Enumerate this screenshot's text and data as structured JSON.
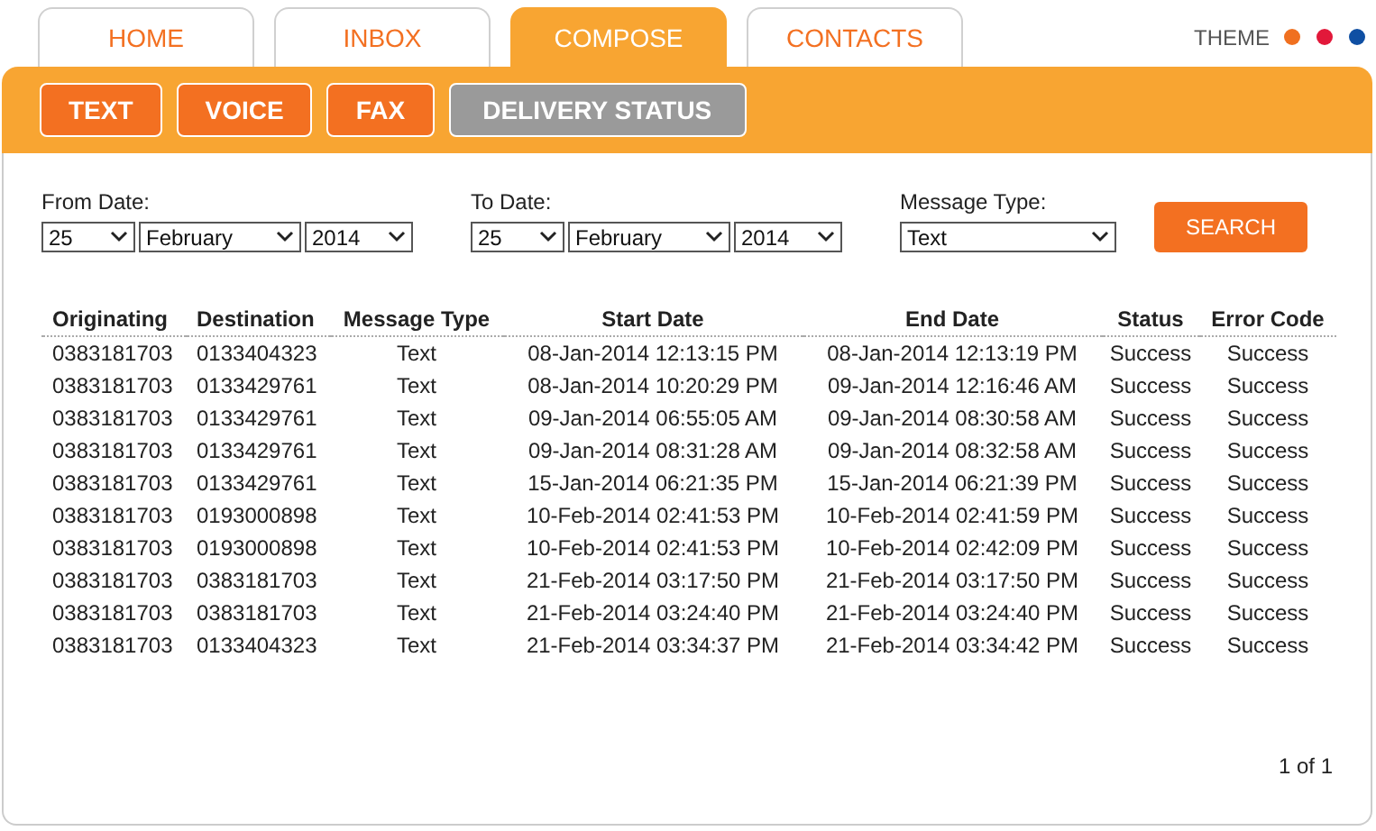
{
  "tabs": [
    {
      "label": "HOME",
      "selected": false
    },
    {
      "label": "INBOX",
      "selected": false
    },
    {
      "label": "COMPOSE",
      "selected": true
    },
    {
      "label": "CONTACTS",
      "selected": false
    }
  ],
  "theme": {
    "label": "THEME",
    "options": [
      {
        "color": "#f07020"
      },
      {
        "color": "#e2183a"
      },
      {
        "color": "#0f4fa3"
      }
    ]
  },
  "subtabs": [
    {
      "label": "TEXT",
      "selected": false
    },
    {
      "label": "VOICE",
      "selected": false
    },
    {
      "label": "FAX",
      "selected": false
    },
    {
      "label": "DELIVERY STATUS",
      "selected": true
    }
  ],
  "filters": [
    {
      "label": "From Date:",
      "fields": [
        {
          "value": "25",
          "kind": "day"
        },
        {
          "value": "February",
          "kind": "month"
        },
        {
          "value": "2014",
          "kind": "year"
        }
      ]
    },
    {
      "label": "To Date:",
      "fields": [
        {
          "value": "25",
          "kind": "day"
        },
        {
          "value": "February",
          "kind": "month"
        },
        {
          "value": "2014",
          "kind": "year"
        }
      ]
    },
    {
      "label": "Message Type:",
      "fields": [
        {
          "value": "Text",
          "kind": "type"
        }
      ]
    }
  ],
  "search_button": "SEARCH",
  "table": {
    "columns": [
      "Originating",
      "Destination",
      "Message Type",
      "Start Date",
      "End Date",
      "Status",
      "Error Code"
    ],
    "rows": [
      [
        "0383181703",
        "0133404323",
        "Text",
        "08-Jan-2014 12:13:15 PM",
        "08-Jan-2014 12:13:19 PM",
        "Success",
        "Success"
      ],
      [
        "0383181703",
        "0133429761",
        "Text",
        "08-Jan-2014 10:20:29 PM",
        "09-Jan-2014 12:16:46 AM",
        "Success",
        "Success"
      ],
      [
        "0383181703",
        "0133429761",
        "Text",
        "09-Jan-2014 06:55:05 AM",
        "09-Jan-2014 08:30:58 AM",
        "Success",
        "Success"
      ],
      [
        "0383181703",
        "0133429761",
        "Text",
        "09-Jan-2014 08:31:28 AM",
        "09-Jan-2014 08:32:58 AM",
        "Success",
        "Success"
      ],
      [
        "0383181703",
        "0133429761",
        "Text",
        "15-Jan-2014 06:21:35 PM",
        "15-Jan-2014 06:21:39 PM",
        "Success",
        "Success"
      ],
      [
        "0383181703",
        "0193000898",
        "Text",
        "10-Feb-2014 02:41:53 PM",
        "10-Feb-2014 02:41:59 PM",
        "Success",
        "Success"
      ],
      [
        "0383181703",
        "0193000898",
        "Text",
        "10-Feb-2014 02:41:53 PM",
        "10-Feb-2014 02:42:09 PM",
        "Success",
        "Success"
      ],
      [
        "0383181703",
        "0383181703",
        "Text",
        "21-Feb-2014 03:17:50 PM",
        "21-Feb-2014 03:17:50 PM",
        "Success",
        "Success"
      ],
      [
        "0383181703",
        "0383181703",
        "Text",
        "21-Feb-2014 03:24:40 PM",
        "21-Feb-2014 03:24:40 PM",
        "Success",
        "Success"
      ],
      [
        "0383181703",
        "0133404323",
        "Text",
        "21-Feb-2014 03:34:37 PM",
        "21-Feb-2014 03:34:42 PM",
        "Success",
        "Success"
      ]
    ]
  },
  "pagination": "1 of 1"
}
